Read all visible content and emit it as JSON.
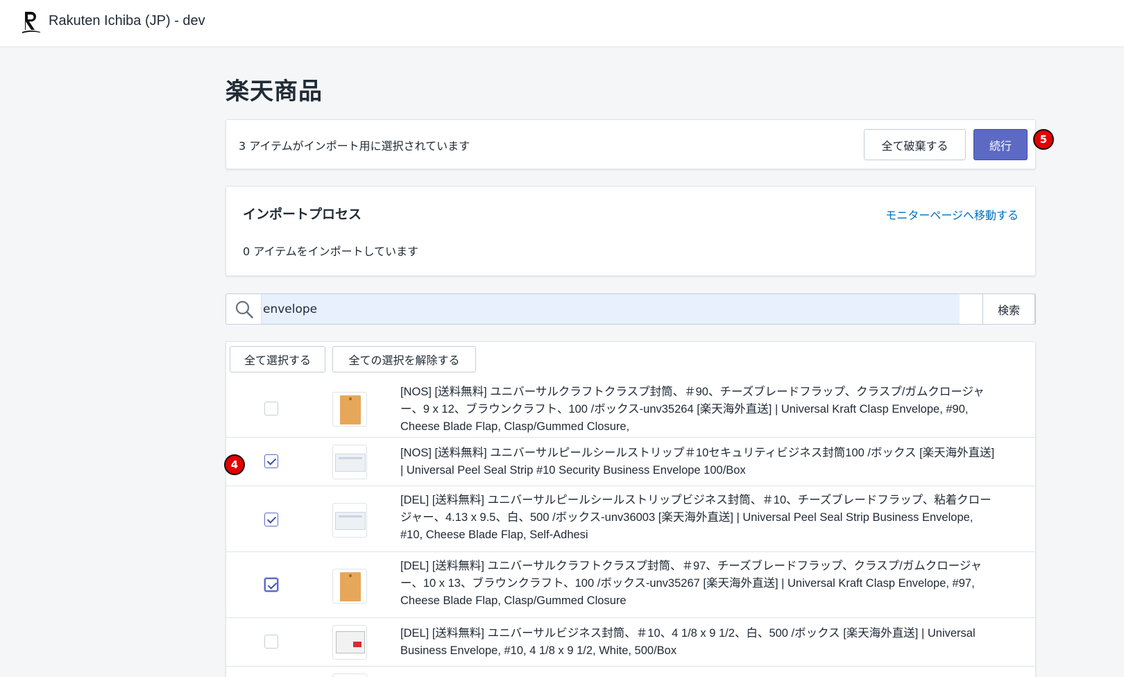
{
  "app": {
    "title": "Rakuten Ichiba (JP) - dev"
  },
  "page": {
    "title": "楽天商品"
  },
  "selection": {
    "text": "3 アイテムがインポート用に選択されています",
    "discard_label": "全て破棄する",
    "continue_label": "続行"
  },
  "process": {
    "title": "インポートプロセス",
    "link_label": "モニターページへ移動する",
    "status": "0 アイテムをインポートしています"
  },
  "search": {
    "value": "envelope",
    "button_label": "検索"
  },
  "bulk": {
    "select_all_label": "全て選択する",
    "deselect_all_label": "全ての選択を解除する"
  },
  "badges": {
    "continue_marker": "5",
    "row_marker": "4"
  },
  "products": [
    {
      "checked": false,
      "thumb": "kraft-envelope",
      "title": "[NOS] [送料無料] ユニバーサルクラフトクラスプ封筒、＃90、チーズブレードフラップ、クラスプ/ガムクロージャー、9 x 12、ブラウンクラフト、100 /ボックス-unv35264 [楽天海外直送] | Universal Kraft Clasp Envelope, #90, Cheese Blade Flap, Clasp/Gummed Closure,"
    },
    {
      "checked": true,
      "thumb": "white-envelope",
      "title": "[NOS] [送料無料] ユニバーサルピールシールストリップ＃10セキュリティビジネス封筒100 /ボックス [楽天海外直送] | Universal Peel Seal Strip #10 Security Business Envelope 100/Box"
    },
    {
      "checked": true,
      "thumb": "white-envelope",
      "title": "[DEL] [送料無料] ユニバーサルピールシールストリップビジネス封筒、＃10、チーズブレードフラップ、粘着クロージャー、4.13 x 9.5、白、500 /ボックス-unv36003 [楽天海外直送] | Universal Peel Seal Strip Business Envelope, #10, Cheese Blade Flap, Self-Adhesi"
    },
    {
      "checked": true,
      "thumb": "kraft-envelope",
      "title": "[DEL] [送料無料] ユニバーサルクラフトクラスプ封筒、＃97、チーズブレードフラップ、クラスプ/ガムクロージャー、10 x 13、ブラウンクラフト、100 /ボックス-unv35267 [楽天海外直送] | Universal Kraft Clasp Envelope, #97, Cheese Blade Flap, Clasp/Gummed Closure"
    },
    {
      "checked": false,
      "thumb": "envelope-box",
      "title": "[DEL] [送料無料] ユニバーサルビジネス封筒、＃10、4 1/8 x 9 1/2、白、500 /ボックス [楽天海外直送] | Universal Business Envelope, #10, 4 1/8 x 9 1/2, White, 500/Box"
    }
  ],
  "colors": {
    "primary": "#5c6ac4",
    "link": "#006fbb",
    "badge": "#e30000",
    "background": "#f4f6f8"
  }
}
